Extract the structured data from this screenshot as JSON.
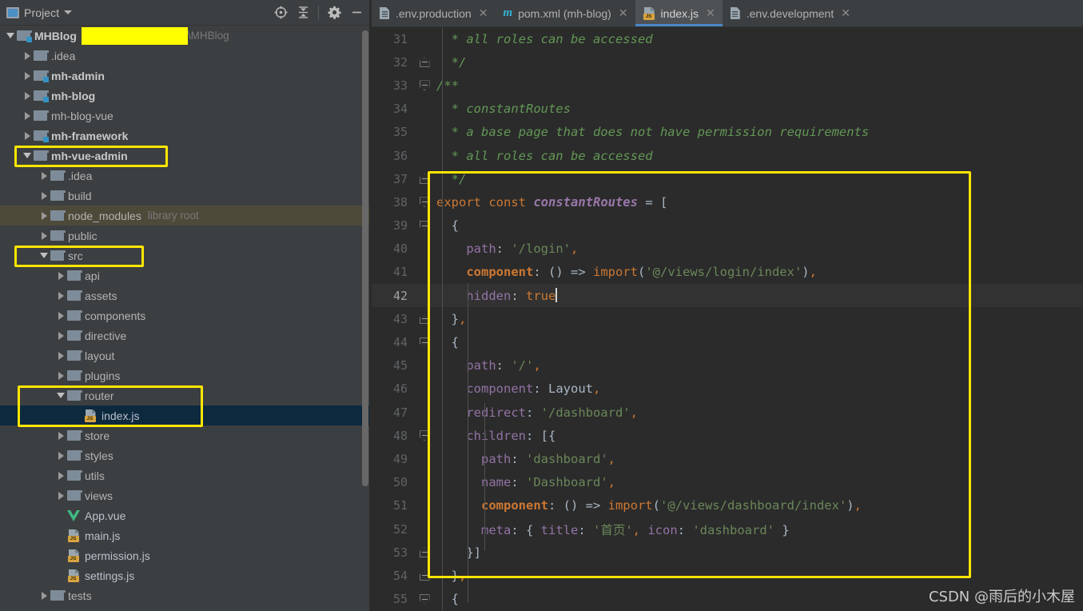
{
  "panel": {
    "title": "Project",
    "icons": {
      "project": "project-icon",
      "dropdown": "chevron-down-icon",
      "locate": "locate-target-icon",
      "collapse_all": "collapse-all-icon",
      "settings": "gear-icon",
      "minimize": "minimize-icon"
    }
  },
  "tree": [
    {
      "indent": 0,
      "twisty": "down",
      "icon": "folder-module",
      "label": "MHBlog",
      "bold": true,
      "redacted": true,
      "hint": "\\MHBlog"
    },
    {
      "indent": 1,
      "twisty": "right",
      "icon": "folder",
      "label": ".idea",
      "bold": false
    },
    {
      "indent": 1,
      "twisty": "right",
      "icon": "folder-module",
      "label": "mh-admin",
      "bold": true
    },
    {
      "indent": 1,
      "twisty": "right",
      "icon": "folder-module",
      "label": "mh-blog",
      "bold": true
    },
    {
      "indent": 1,
      "twisty": "right",
      "icon": "folder",
      "label": "mh-blog-vue",
      "bold": false
    },
    {
      "indent": 1,
      "twisty": "right",
      "icon": "folder-module",
      "label": "mh-framework",
      "bold": true
    },
    {
      "indent": 1,
      "twisty": "down",
      "icon": "folder",
      "label": "mh-vue-admin",
      "bold": true
    },
    {
      "indent": 2,
      "twisty": "right",
      "icon": "folder",
      "label": ".idea",
      "bold": false
    },
    {
      "indent": 2,
      "twisty": "right",
      "icon": "folder",
      "label": "build",
      "bold": false
    },
    {
      "indent": 2,
      "twisty": "right",
      "icon": "folder",
      "label": "node_modules",
      "bold": false,
      "hint": "library root",
      "libroot": true
    },
    {
      "indent": 2,
      "twisty": "right",
      "icon": "folder",
      "label": "public",
      "bold": false
    },
    {
      "indent": 2,
      "twisty": "down",
      "icon": "folder",
      "label": "src",
      "bold": false
    },
    {
      "indent": 3,
      "twisty": "right",
      "icon": "folder",
      "label": "api",
      "bold": false
    },
    {
      "indent": 3,
      "twisty": "right",
      "icon": "folder",
      "label": "assets",
      "bold": false
    },
    {
      "indent": 3,
      "twisty": "right",
      "icon": "folder",
      "label": "components",
      "bold": false
    },
    {
      "indent": 3,
      "twisty": "right",
      "icon": "folder",
      "label": "directive",
      "bold": false
    },
    {
      "indent": 3,
      "twisty": "right",
      "icon": "folder",
      "label": "layout",
      "bold": false
    },
    {
      "indent": 3,
      "twisty": "right",
      "icon": "folder",
      "label": "plugins",
      "bold": false
    },
    {
      "indent": 3,
      "twisty": "down",
      "icon": "folder",
      "label": "router",
      "bold": false
    },
    {
      "indent": 4,
      "twisty": "none",
      "icon": "js-file",
      "label": "index.js",
      "bold": false,
      "selected": true
    },
    {
      "indent": 3,
      "twisty": "right",
      "icon": "folder",
      "label": "store",
      "bold": false
    },
    {
      "indent": 3,
      "twisty": "right",
      "icon": "folder",
      "label": "styles",
      "bold": false
    },
    {
      "indent": 3,
      "twisty": "right",
      "icon": "folder",
      "label": "utils",
      "bold": false
    },
    {
      "indent": 3,
      "twisty": "right",
      "icon": "folder",
      "label": "views",
      "bold": false
    },
    {
      "indent": 3,
      "twisty": "none",
      "icon": "vue-file",
      "label": "App.vue",
      "bold": false
    },
    {
      "indent": 3,
      "twisty": "none",
      "icon": "js-file",
      "label": "main.js",
      "bold": false
    },
    {
      "indent": 3,
      "twisty": "none",
      "icon": "js-file",
      "label": "permission.js",
      "bold": false
    },
    {
      "indent": 3,
      "twisty": "none",
      "icon": "js-file",
      "label": "settings.js",
      "bold": false
    },
    {
      "indent": 2,
      "twisty": "right",
      "icon": "folder",
      "label": "tests",
      "bold": false
    }
  ],
  "tabs": [
    {
      "label": ".env.production",
      "icon": "env-file-icon",
      "active": false,
      "close": "✕"
    },
    {
      "label": "pom.xml (mh-blog)",
      "icon": "maven-icon",
      "active": false,
      "close": "✕"
    },
    {
      "label": "index.js",
      "icon": "js-file-icon",
      "active": true,
      "close": "✕"
    },
    {
      "label": ".env.development",
      "icon": "env-file-icon",
      "active": false,
      "close": "✕"
    }
  ],
  "editor": {
    "first_line": 31,
    "current_line": 42,
    "lines": [
      {
        "n": 31,
        "fold": "",
        "tokens": [
          {
            "t": "  * all roles can be accessed",
            "c": "c-comment"
          }
        ]
      },
      {
        "n": 32,
        "fold": "minus",
        "tokens": [
          {
            "t": "  */",
            "c": "c-comment"
          }
        ]
      },
      {
        "n": 33,
        "fold": "arrow",
        "tokens": [
          {
            "t": "/**",
            "c": "c-comment"
          }
        ]
      },
      {
        "n": 34,
        "fold": "",
        "tokens": [
          {
            "t": "  * constantRoutes",
            "c": "c-comment"
          }
        ]
      },
      {
        "n": 35,
        "fold": "",
        "tokens": [
          {
            "t": "  * a base page that does not have permission requirements",
            "c": "c-comment"
          }
        ]
      },
      {
        "n": 36,
        "fold": "",
        "tokens": [
          {
            "t": "  * all roles can be accessed",
            "c": "c-comment"
          }
        ]
      },
      {
        "n": 37,
        "fold": "minus",
        "tokens": [
          {
            "t": "  */",
            "c": "c-comment"
          }
        ]
      },
      {
        "n": 38,
        "fold": "arrow",
        "tokens": [
          {
            "t": "export const ",
            "c": "c-kw"
          },
          {
            "t": "constantRoutes",
            "c": "c-ident"
          },
          {
            "t": " = [",
            "c": "c-plain"
          }
        ]
      },
      {
        "n": 39,
        "fold": "arrow",
        "tokens": [
          {
            "t": "  {",
            "c": "c-plain"
          }
        ]
      },
      {
        "n": 40,
        "fold": "",
        "tokens": [
          {
            "t": "    path",
            "c": "c-prop"
          },
          {
            "t": ": ",
            "c": "c-plain"
          },
          {
            "t": "'/login'",
            "c": "c-str"
          },
          {
            "t": ",",
            "c": "c-comma"
          }
        ]
      },
      {
        "n": 41,
        "fold": "",
        "tokens": [
          {
            "t": "    component",
            "c": "c-kwb"
          },
          {
            "t": ": () => ",
            "c": "c-plain"
          },
          {
            "t": "import",
            "c": "c-fn"
          },
          {
            "t": "(",
            "c": "c-plain"
          },
          {
            "t": "'@/views/login/index'",
            "c": "c-str"
          },
          {
            "t": ")",
            "c": "c-plain"
          },
          {
            "t": ",",
            "c": "c-comma"
          }
        ]
      },
      {
        "n": 42,
        "fold": "",
        "current": true,
        "caret": true,
        "tokens": [
          {
            "t": "    hidden",
            "c": "c-prop"
          },
          {
            "t": ": ",
            "c": "c-plain"
          },
          {
            "t": "true",
            "c": "c-kw"
          }
        ]
      },
      {
        "n": 43,
        "fold": "minus",
        "tokens": [
          {
            "t": "  }",
            "c": "c-plain"
          },
          {
            "t": ",",
            "c": "c-comma"
          }
        ]
      },
      {
        "n": 44,
        "fold": "arrow",
        "tokens": [
          {
            "t": "  {",
            "c": "c-plain"
          }
        ]
      },
      {
        "n": 45,
        "fold": "",
        "tokens": [
          {
            "t": "    path",
            "c": "c-prop"
          },
          {
            "t": ": ",
            "c": "c-plain"
          },
          {
            "t": "'/'",
            "c": "c-str"
          },
          {
            "t": ",",
            "c": "c-comma"
          }
        ]
      },
      {
        "n": 46,
        "fold": "",
        "tokens": [
          {
            "t": "    component",
            "c": "c-prop"
          },
          {
            "t": ": Layout",
            "c": "c-plain"
          },
          {
            "t": ",",
            "c": "c-comma"
          }
        ]
      },
      {
        "n": 47,
        "fold": "",
        "tokens": [
          {
            "t": "    redirect",
            "c": "c-prop"
          },
          {
            "t": ": ",
            "c": "c-plain"
          },
          {
            "t": "'/dashboard'",
            "c": "c-str"
          },
          {
            "t": ",",
            "c": "c-comma"
          }
        ]
      },
      {
        "n": 48,
        "fold": "arrow",
        "tokens": [
          {
            "t": "    children",
            "c": "c-prop"
          },
          {
            "t": ": [{",
            "c": "c-plain"
          }
        ]
      },
      {
        "n": 49,
        "fold": "",
        "tokens": [
          {
            "t": "      path",
            "c": "c-prop"
          },
          {
            "t": ": ",
            "c": "c-plain"
          },
          {
            "t": "'dashboard'",
            "c": "c-str"
          },
          {
            "t": ",",
            "c": "c-comma"
          }
        ]
      },
      {
        "n": 50,
        "fold": "",
        "tokens": [
          {
            "t": "      name",
            "c": "c-prop"
          },
          {
            "t": ": ",
            "c": "c-plain"
          },
          {
            "t": "'Dashboard'",
            "c": "c-str"
          },
          {
            "t": ",",
            "c": "c-comma"
          }
        ]
      },
      {
        "n": 51,
        "fold": "",
        "tokens": [
          {
            "t": "      component",
            "c": "c-kwb"
          },
          {
            "t": ": () => ",
            "c": "c-plain"
          },
          {
            "t": "import",
            "c": "c-fn"
          },
          {
            "t": "(",
            "c": "c-plain"
          },
          {
            "t": "'@/views/dashboard/index'",
            "c": "c-str"
          },
          {
            "t": ")",
            "c": "c-plain"
          },
          {
            "t": ",",
            "c": "c-comma"
          }
        ]
      },
      {
        "n": 52,
        "fold": "",
        "tokens": [
          {
            "t": "      meta",
            "c": "c-prop"
          },
          {
            "t": ": { ",
            "c": "c-plain"
          },
          {
            "t": "title",
            "c": "c-prop"
          },
          {
            "t": ": ",
            "c": "c-plain"
          },
          {
            "t": "'首页'",
            "c": "c-str"
          },
          {
            "t": ", ",
            "c": "c-comma"
          },
          {
            "t": "icon",
            "c": "c-prop"
          },
          {
            "t": ": ",
            "c": "c-plain"
          },
          {
            "t": "'dashboard'",
            "c": "c-str"
          },
          {
            "t": " }",
            "c": "c-plain"
          }
        ]
      },
      {
        "n": 53,
        "fold": "minus",
        "tokens": [
          {
            "t": "    }]",
            "c": "c-plain"
          }
        ]
      },
      {
        "n": 54,
        "fold": "minus",
        "tokens": [
          {
            "t": "  }",
            "c": "c-plain"
          },
          {
            "t": ",",
            "c": "c-comma"
          }
        ]
      },
      {
        "n": 55,
        "fold": "arrow",
        "tokens": [
          {
            "t": "  {",
            "c": "c-plain"
          }
        ]
      }
    ]
  },
  "watermark": "CSDN @雨后的小木屋",
  "colors": {
    "panel_bg": "#3c3f41",
    "editor_bg": "#2b2b2b",
    "highlight_yellow": "#ffe600",
    "redaction_yellow": "#ffff00",
    "selection_blue": "#0d293e",
    "tab_accent": "#4a88c7",
    "libroot_bg": "#4e4a3a",
    "current_line_bg": "#323232"
  }
}
